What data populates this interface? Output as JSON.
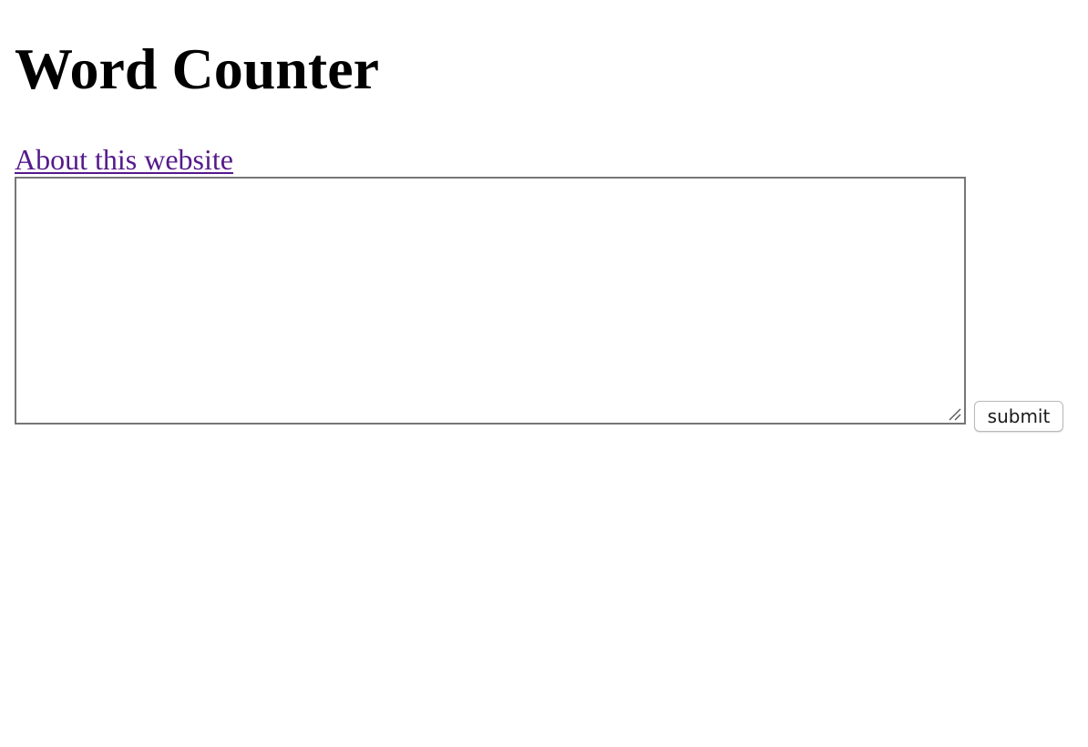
{
  "header": {
    "title": "Word Counter"
  },
  "nav": {
    "about_link": "About this website"
  },
  "form": {
    "text_value": "",
    "submit_label": "submit"
  },
  "colors": {
    "link": "#551a8b",
    "textarea_border": "#767676",
    "button_border": "#b8b8b8"
  },
  "icons": {
    "resize_handle": "resize-grip-icon"
  }
}
